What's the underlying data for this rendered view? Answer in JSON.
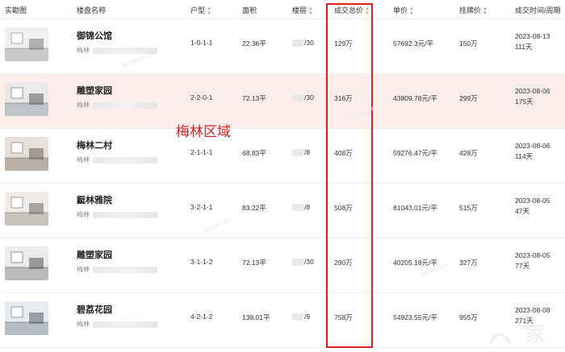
{
  "columns": {
    "photo": "实勘图",
    "name": "楼盘名称",
    "layout": "户型",
    "area": "面积",
    "floor": "楼层",
    "total_price": "成交总价",
    "unit_price": "单价",
    "list_price": "挂牌价",
    "deal_time": "成交时间/周期"
  },
  "annotation": "梅林区域",
  "rows": [
    {
      "name": "御锦公馆",
      "district": "梅林",
      "layout": "1-0-1-1",
      "area": "22.36平",
      "floor": "/30",
      "total": "129万",
      "unit": "57692.3元/平",
      "list": "150万",
      "date": "2023-08-13",
      "cycle": "111天"
    },
    {
      "name": "雕塑家园",
      "district": "梅林",
      "layout": "2-2-0-1",
      "area": "72.13平",
      "floor": "/30",
      "total": "316万",
      "unit": "43809.78元/平",
      "list": "299万",
      "date": "2023-08-06",
      "cycle": "175天"
    },
    {
      "name": "梅林二村",
      "district": "梅林",
      "layout": "2-1-1-1",
      "area": "68.83平",
      "floor": "/8",
      "total": "408万",
      "unit": "59276.47元/平",
      "list": "428万",
      "date": "2023-08-06",
      "cycle": "114天"
    },
    {
      "name": "鼮林雅院",
      "district": "梅林",
      "layout": "3-2-1-1",
      "area": "83.22平",
      "floor": "/8",
      "total": "508万",
      "unit": "61043.01元/平",
      "list": "515万",
      "date": "2023-08-05",
      "cycle": "47天"
    },
    {
      "name": "雕塑家园",
      "district": "梅林",
      "layout": "3-1-1-2",
      "area": "72.13平",
      "floor": "/30",
      "total": "290万",
      "unit": "40205.18元/平",
      "list": "327万",
      "date": "2023-08-05",
      "cycle": "77天"
    },
    {
      "name": "碧荔花园",
      "district": "梅林",
      "layout": "4-2-1-2",
      "area": "138.01平",
      "floor": "/9",
      "total": "758万",
      "unit": "54923.55元/平",
      "list": "955万",
      "date": "2023-08-08",
      "cycle": "271天"
    }
  ],
  "logo_text": "家",
  "colors": {
    "highlight_row": "#fdeeee",
    "annotation_red": "#e02020"
  }
}
